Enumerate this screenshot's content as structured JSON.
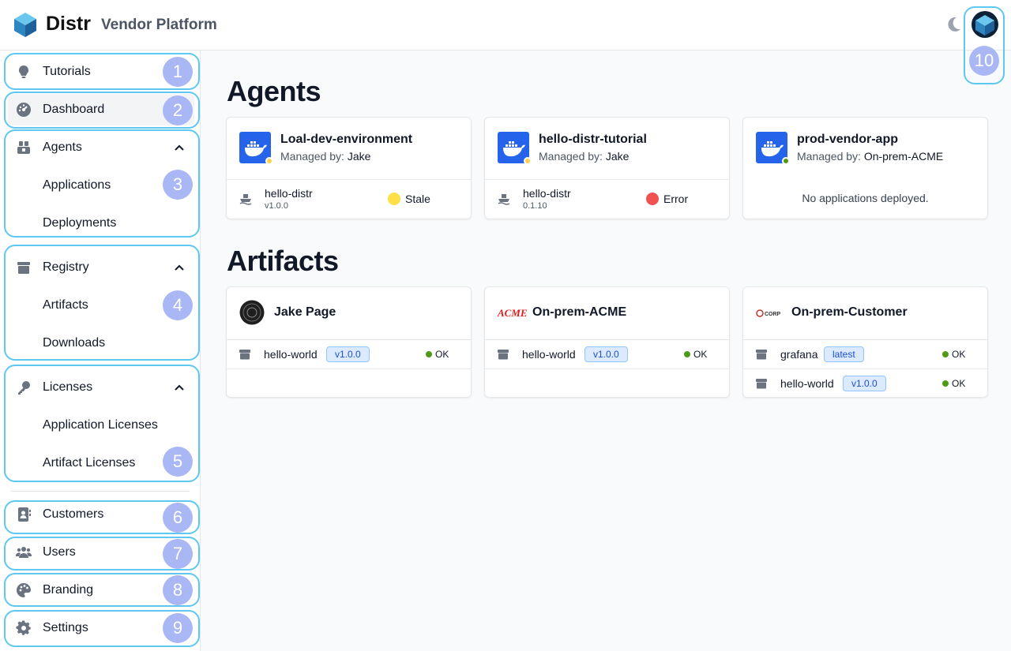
{
  "header": {
    "brand": "Distr",
    "subtitle": "Vendor Platform"
  },
  "sidebar": {
    "items": [
      {
        "label": "Tutorials",
        "icon": "lightbulb-icon"
      },
      {
        "label": "Dashboard",
        "icon": "dashboard-icon",
        "active": true
      },
      {
        "label": "Agents",
        "icon": "agents-icon",
        "children": [
          "Applications",
          "Deployments"
        ]
      },
      {
        "label": "Registry",
        "icon": "box-icon",
        "children": [
          "Artifacts",
          "Downloads"
        ]
      },
      {
        "label": "Licenses",
        "icon": "key-icon",
        "children": [
          "Application Licenses",
          "Artifact Licenses"
        ]
      },
      {
        "label": "Customers",
        "icon": "address-book-icon"
      },
      {
        "label": "Users",
        "icon": "users-icon"
      },
      {
        "label": "Branding",
        "icon": "palette-icon"
      },
      {
        "label": "Settings",
        "icon": "gear-icon"
      }
    ]
  },
  "badges": [
    "1",
    "2",
    "3",
    "4",
    "5",
    "6",
    "7",
    "8",
    "9",
    "10"
  ],
  "main": {
    "agents_title": "Agents",
    "artifacts_title": "Artifacts",
    "managed_prefix": "Managed by:",
    "agents": [
      {
        "name": "Loal-dev-environment",
        "managed_by": "Jake",
        "status_color": "#fcd34d",
        "deployment": {
          "name": "hello-distr",
          "version": "v1.0.0",
          "status": "Stale",
          "status_color": "#fde047"
        }
      },
      {
        "name": "hello-distr-tutorial",
        "managed_by": "Jake",
        "status_color": "#fcd34d",
        "deployment": {
          "name": "hello-distr",
          "version": "0.1.10",
          "status": "Error",
          "status_color": "#f05252"
        }
      },
      {
        "name": "prod-vendor-app",
        "managed_by": "On-prem-ACME",
        "status_color": "#4d9a15",
        "empty": "No applications deployed."
      }
    ],
    "artifacts": [
      {
        "owner": "Jake Page",
        "logo": "avatar-logo",
        "rows": [
          {
            "name": "hello-world",
            "tag": "v1.0.0",
            "status": "OK"
          }
        ]
      },
      {
        "owner": "On-prem-ACME",
        "logo": "acme-logo",
        "logo_text": "ACME",
        "rows": [
          {
            "name": "hello-world",
            "tag": "v1.0.0",
            "status": "OK"
          }
        ]
      },
      {
        "owner": "On-prem-Customer",
        "logo": "corp-logo",
        "logo_text": "CORP",
        "rows": [
          {
            "name": "grafana",
            "tag": "latest",
            "status": "OK"
          },
          {
            "name": "hello-world",
            "tag": "v1.0.0",
            "status": "OK"
          }
        ]
      }
    ]
  },
  "colors": {
    "accent": "#2563eb",
    "highlight": "#5ec8f0",
    "badge": "#a9b8f5"
  }
}
